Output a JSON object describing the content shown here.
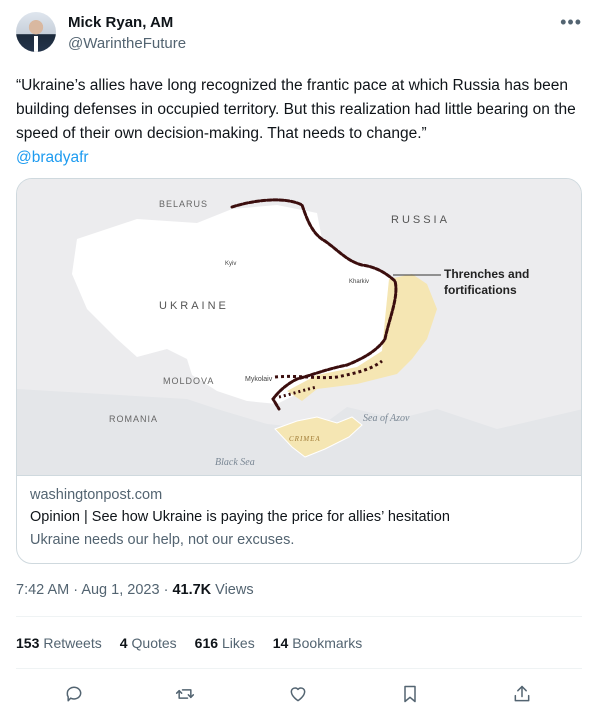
{
  "author": {
    "name": "Mick Ryan, AM",
    "handle": "@WarintheFuture"
  },
  "tweet": {
    "text": "“Ukraine’s allies have long recognized the frantic pace at which Russia has been building defenses in occupied territory. But this realization had little bearing on the speed of their own decision-making. That needs to change.”",
    "mention": "@bradyafr"
  },
  "map": {
    "labels": {
      "belarus": "BELARUS",
      "russia": "RUSSIA",
      "ukraine": "UKRAINE",
      "moldova": "MOLDOVA",
      "romania": "ROMANIA",
      "kyiv": "Kyiv",
      "kharkiv": "Kharkiv",
      "mykolaiv": "Mykolaiv",
      "crimea": "CRIMEA",
      "sea_azov": "Sea of Azov",
      "black_sea": "Black Sea",
      "legend_line1": "Threnches and",
      "legend_line2": "fortifications"
    },
    "colors": {
      "trench": "#3b0e0e",
      "occupied": "#f5e6b3",
      "land": "#ffffff",
      "water": "#e4e6e9"
    }
  },
  "card": {
    "domain": "washingtonpost.com",
    "title": "Opinion | See how Ukraine is paying the price for allies’ hesitation",
    "description": "Ukraine needs our help, not our excuses."
  },
  "meta": {
    "time": "7:42 AM",
    "sep": "·",
    "date": "Aug 1, 2023",
    "views_count": "41.7K",
    "views_label": "Views"
  },
  "stats": {
    "retweets_count": "153",
    "retweets_label": "Retweets",
    "quotes_count": "4",
    "quotes_label": "Quotes",
    "likes_count": "616",
    "likes_label": "Likes",
    "bookmarks_count": "14",
    "bookmarks_label": "Bookmarks"
  },
  "icons": [
    "more-icon",
    "reply-icon",
    "retweet-icon",
    "like-icon",
    "bookmark-icon",
    "share-icon"
  ]
}
